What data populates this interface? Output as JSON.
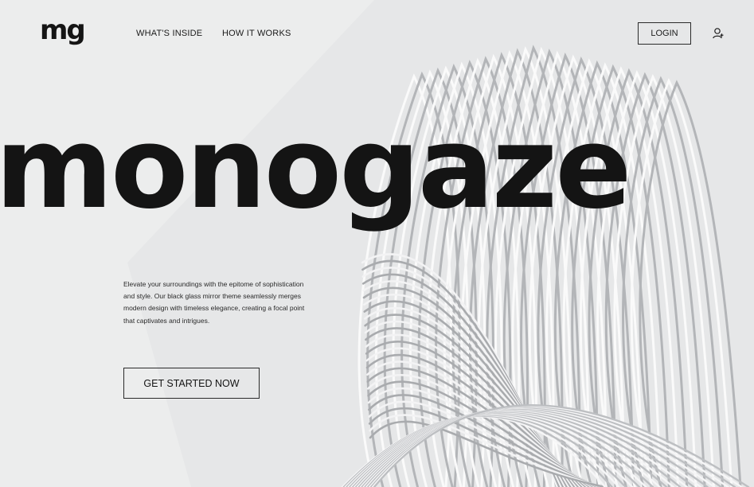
{
  "header": {
    "logo": "mg",
    "nav": [
      {
        "label": "WHAT'S INSIDE"
      },
      {
        "label": "HOW IT WORKS"
      }
    ],
    "login_label": "LOGIN",
    "user_icon": "user-plus-icon"
  },
  "hero": {
    "title": "monogaze",
    "description": "Elevate your surroundings with the epitome of sophistication and style. Our black glass mirror theme seamlessly merges modern design with timeless elegance, creating a focal point that captivates and intrigues.",
    "cta_label": "GET STARTED NOW"
  },
  "colors": {
    "background": "#eceded",
    "text": "#141414",
    "sculpture": "#c9cbce"
  }
}
